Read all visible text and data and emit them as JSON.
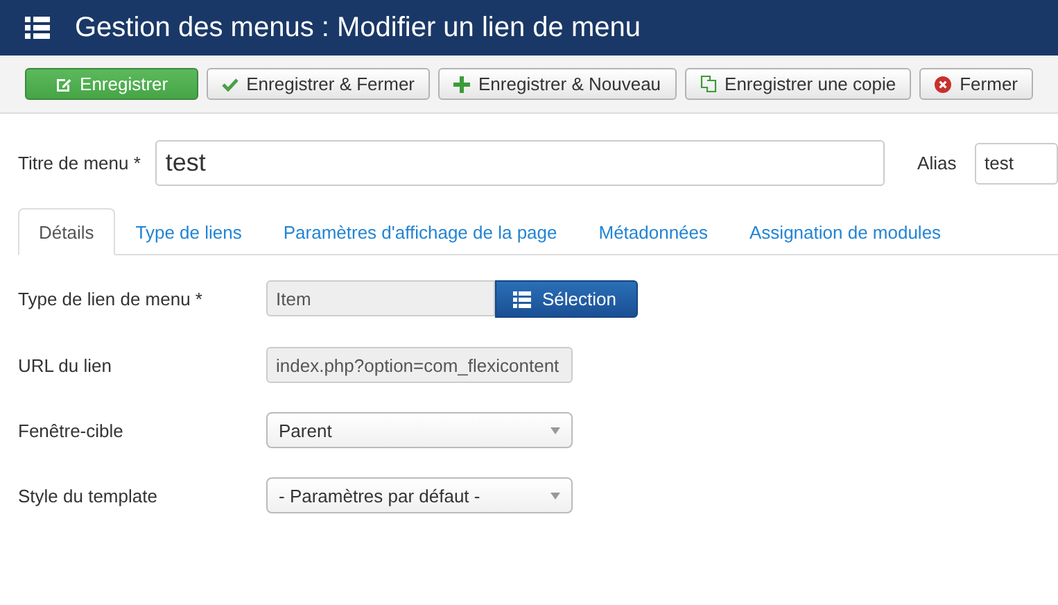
{
  "header": {
    "title": "Gestion des menus : Modifier un lien de menu"
  },
  "toolbar": [
    {
      "kind": "save",
      "label": "Enregistrer"
    },
    {
      "kind": "save-close",
      "label": "Enregistrer & Fermer"
    },
    {
      "kind": "save-new",
      "label": "Enregistrer & Nouveau"
    },
    {
      "kind": "save-copy",
      "label": "Enregistrer une copie"
    },
    {
      "kind": "close",
      "label": "Fermer"
    }
  ],
  "title_field": {
    "label": "Titre de menu *",
    "value": "test"
  },
  "alias_field": {
    "label": "Alias",
    "value": "test"
  },
  "tabs": [
    {
      "label": "Détails",
      "selected": true
    },
    {
      "label": "Type de liens",
      "selected": false
    },
    {
      "label": "Paramètres d'affichage de la page",
      "selected": false
    },
    {
      "label": "Métadonnées",
      "selected": false
    },
    {
      "label": "Assignation de modules",
      "selected": false
    }
  ],
  "fields": [
    {
      "kind": "picker",
      "label": "Type de lien de menu *",
      "value": "Item",
      "button": "Sélection"
    },
    {
      "kind": "readonly",
      "label": "URL du lien",
      "value": "index.php?option=com_flexicontent"
    },
    {
      "kind": "select",
      "label": "Fenêtre-cible",
      "value": "Parent"
    },
    {
      "kind": "select",
      "label": "Style du template",
      "value": "- Paramètres par défaut -"
    }
  ]
}
